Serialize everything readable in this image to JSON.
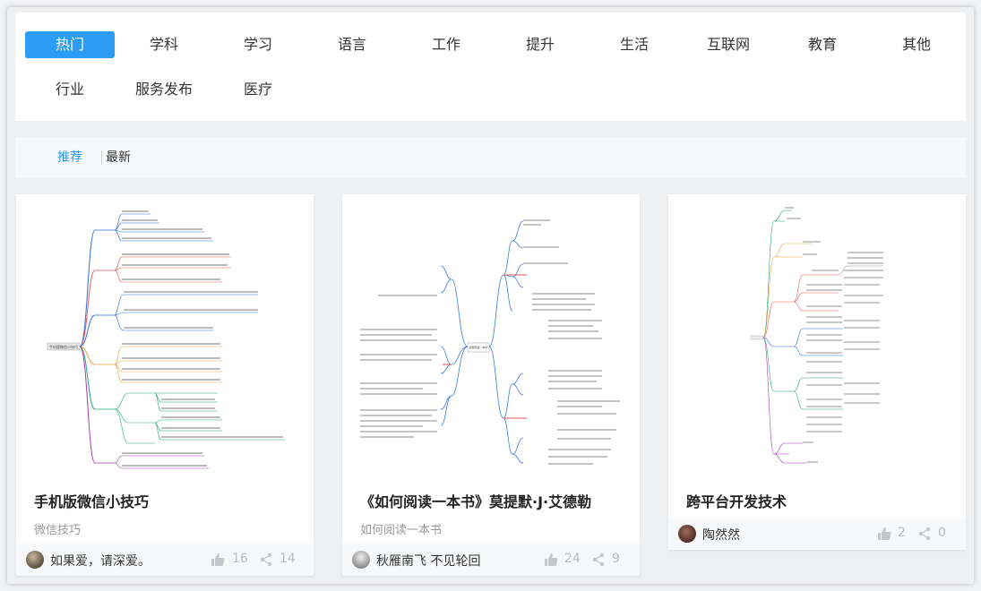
{
  "categories": {
    "row1": [
      "热门",
      "学科",
      "学习",
      "语言",
      "工作",
      "提升",
      "生活",
      "互联网",
      "教育",
      "其他"
    ],
    "row2": [
      "行业",
      "服务发布",
      "医疗"
    ]
  },
  "sort": {
    "recommended": "推荐",
    "latest": "最新"
  },
  "cards": [
    {
      "title": "手机版微信小技巧",
      "subtitle": "微信技巧",
      "author": "如果爱，请深爱。",
      "likes": "16",
      "shares": "14",
      "thumb_center": "手机版微信小技巧"
    },
    {
      "title": "《如何阅读一本书》莫提默·J·艾德勒",
      "subtitle": "如何阅读一本书",
      "author": "秋雁南飞 不见轮回",
      "likes": "24",
      "shares": "9",
      "thumb_center": "如何阅读一本书"
    },
    {
      "title": "跨平台开发技术",
      "subtitle": "",
      "author": "陶然然",
      "likes": "2",
      "shares": "0"
    }
  ],
  "colors": {
    "accent": "#2d9cf5",
    "muted": "#b8bcc2"
  }
}
